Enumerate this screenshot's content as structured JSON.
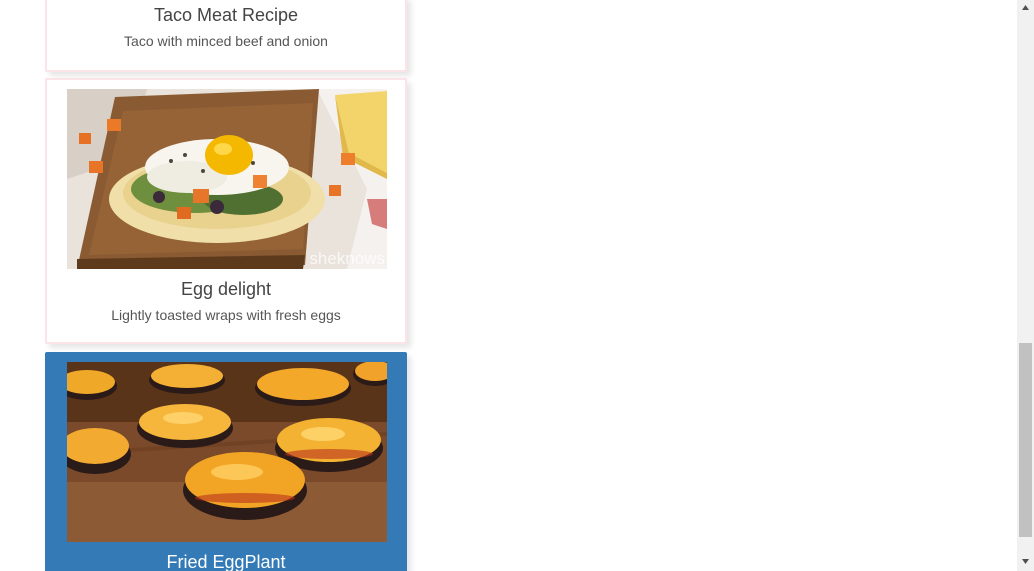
{
  "recipes": [
    {
      "title": "Taco Meat Recipe",
      "description": "Taco with minced beef and onion",
      "image": "taco-photo",
      "selected": false
    },
    {
      "title": "Egg delight",
      "description": "Lightly toasted wraps with fresh eggs",
      "image": "egg-wrap-photo",
      "watermark": "sheknows",
      "selected": false
    },
    {
      "title": "Fried EggPlant",
      "description": "",
      "image": "fried-eggplant-photo",
      "selected": true
    }
  ],
  "colors": {
    "selected_card": "#337ab7",
    "card_border": "#fbe3e7",
    "scroll_thumb": "#c1c1c1",
    "scroll_track": "#f1f1f1"
  },
  "scrollbar": {
    "up_icon": "triangle-up-icon",
    "down_icon": "triangle-down-icon"
  }
}
